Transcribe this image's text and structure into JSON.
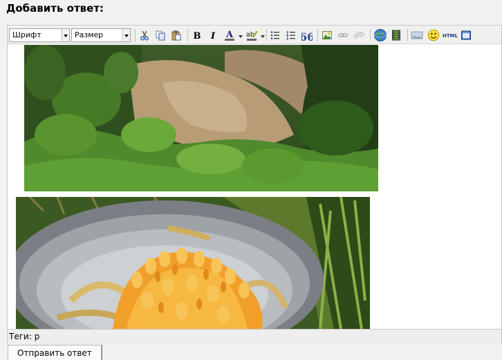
{
  "page": {
    "title": "Добавить ответ:"
  },
  "toolbar": {
    "font_select": {
      "value": "Шрифт"
    },
    "size_select": {
      "value": "Размер"
    },
    "buttons": [
      "cut-icon",
      "copy-icon",
      "paste-icon",
      "bold-icon",
      "italic-icon",
      "font-color-icon",
      "highlight-icon",
      "bullet-list-icon",
      "numbered-list-icon",
      "quote-icon",
      "insert-image-icon",
      "link-icon",
      "unlink-icon",
      "web-link-icon",
      "video-icon",
      "picture-icon",
      "smiley-icon",
      "html-icon",
      "preview-icon"
    ],
    "bold_glyph": "B",
    "italic_glyph": "I",
    "font_color_glyph": "A",
    "highlight_glyph": "ab",
    "quote_glyph": "66",
    "html_label": "HTML",
    "colors": {
      "font_color": "#1f1f8f",
      "highlight": "#f5e400"
    }
  },
  "content": {
    "images": [
      {
        "subject": "forest-hillside"
      },
      {
        "subject": "orange-coral-mushroom-in-bowl"
      }
    ]
  },
  "tags": {
    "label": "Теги:",
    "value": "p"
  },
  "submit": {
    "label": "Отправить ответ"
  }
}
